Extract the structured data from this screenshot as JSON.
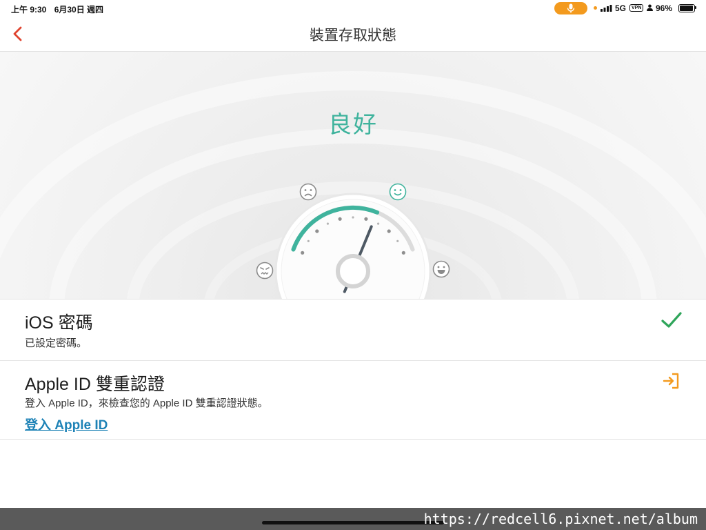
{
  "status_bar": {
    "time": "上午 9:30",
    "date": "6月30日 週四",
    "network": "5G",
    "vpn": "VPN",
    "battery": "96%",
    "battery_level": 0.96,
    "icons": [
      "microphone-icon",
      "signal-icon",
      "person-icon",
      "battery-icon"
    ]
  },
  "nav": {
    "back_icon": "chevron-left-icon",
    "title": "裝置存取狀態"
  },
  "hero": {
    "status": "良好",
    "gauge_level": 0.66,
    "faces": [
      "angry-face-icon",
      "sad-face-icon",
      "smile-face-icon",
      "laugh-face-icon"
    ]
  },
  "items": [
    {
      "title": "iOS 密碼",
      "subtitle": "已設定密碼。",
      "icon": "checkmark-icon"
    },
    {
      "title": "Apple ID 雙重認證",
      "subtitle": "登入 Apple ID，來檢查您的 Apple ID 雙重認證狀態。",
      "link": "登入 Apple ID",
      "icon": "sign-in-icon"
    }
  ],
  "footer": {
    "watermark": "https://redcell6.pixnet.net/album"
  },
  "colors": {
    "accent_red": "#e0442f",
    "good_green": "#3fb39d",
    "check_green": "#2fa55a",
    "action_orange": "#f39a1e",
    "link_blue": "#1d82b6"
  }
}
